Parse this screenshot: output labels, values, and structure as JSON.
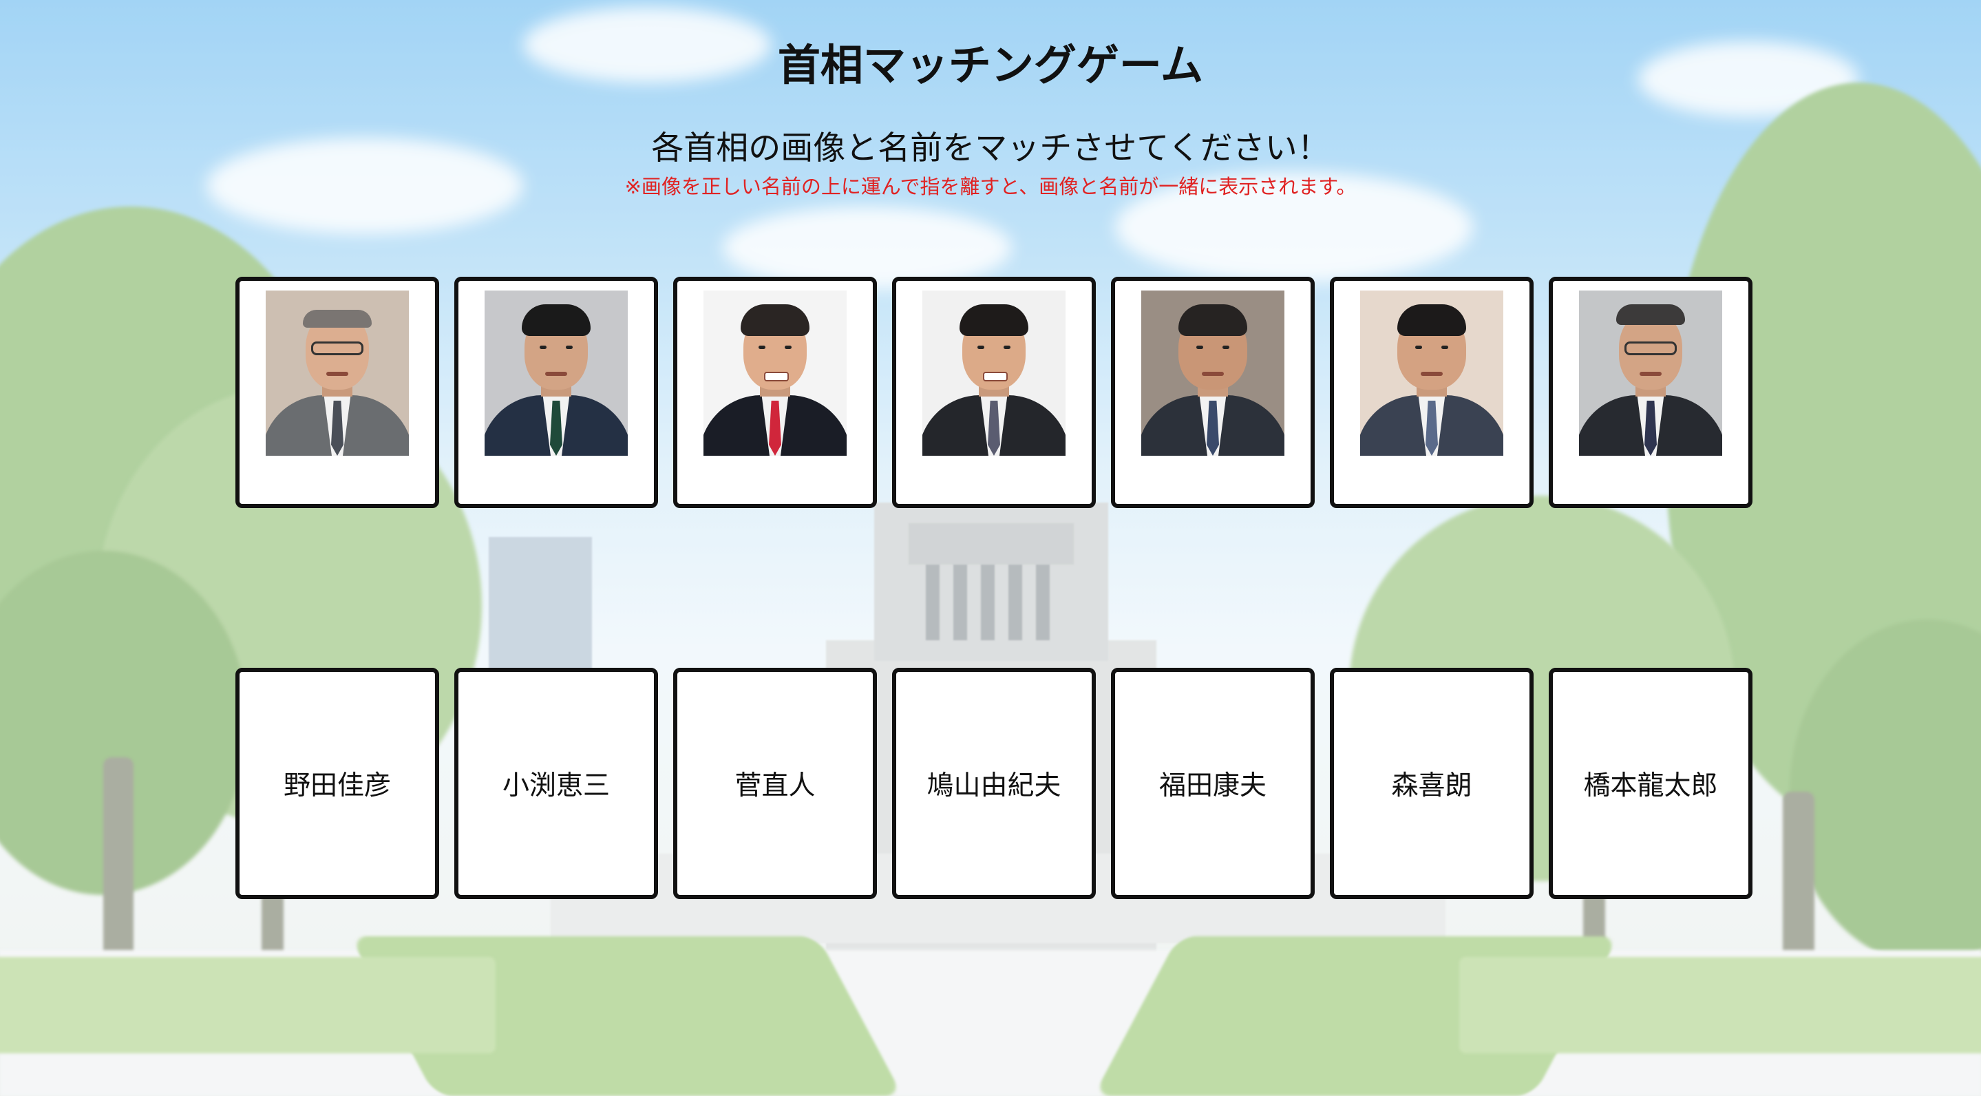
{
  "title": "首相マッチングゲーム",
  "subtitle": "各首相の画像と名前をマッチさせてください！",
  "note": "※画像を正しい名前の上に運んで指を離すと、画像と名前が一緒に表示されます。",
  "colors": {
    "note": "#e02323",
    "card_border": "#111111",
    "card_bg": "#ffffff"
  },
  "photo_cards": [
    {
      "icon": "prime-minister-portrait-1"
    },
    {
      "icon": "prime-minister-portrait-2"
    },
    {
      "icon": "prime-minister-portrait-3"
    },
    {
      "icon": "prime-minister-portrait-4"
    },
    {
      "icon": "prime-minister-portrait-5"
    },
    {
      "icon": "prime-minister-portrait-6"
    },
    {
      "icon": "prime-minister-portrait-7"
    }
  ],
  "name_cards": [
    {
      "label": "野田佳彦"
    },
    {
      "label": "小渕恵三"
    },
    {
      "label": "菅直人"
    },
    {
      "label": "鳩山由紀夫"
    },
    {
      "label": "福田康夫"
    },
    {
      "label": "森喜朗"
    },
    {
      "label": "橋本龍太郎"
    }
  ]
}
